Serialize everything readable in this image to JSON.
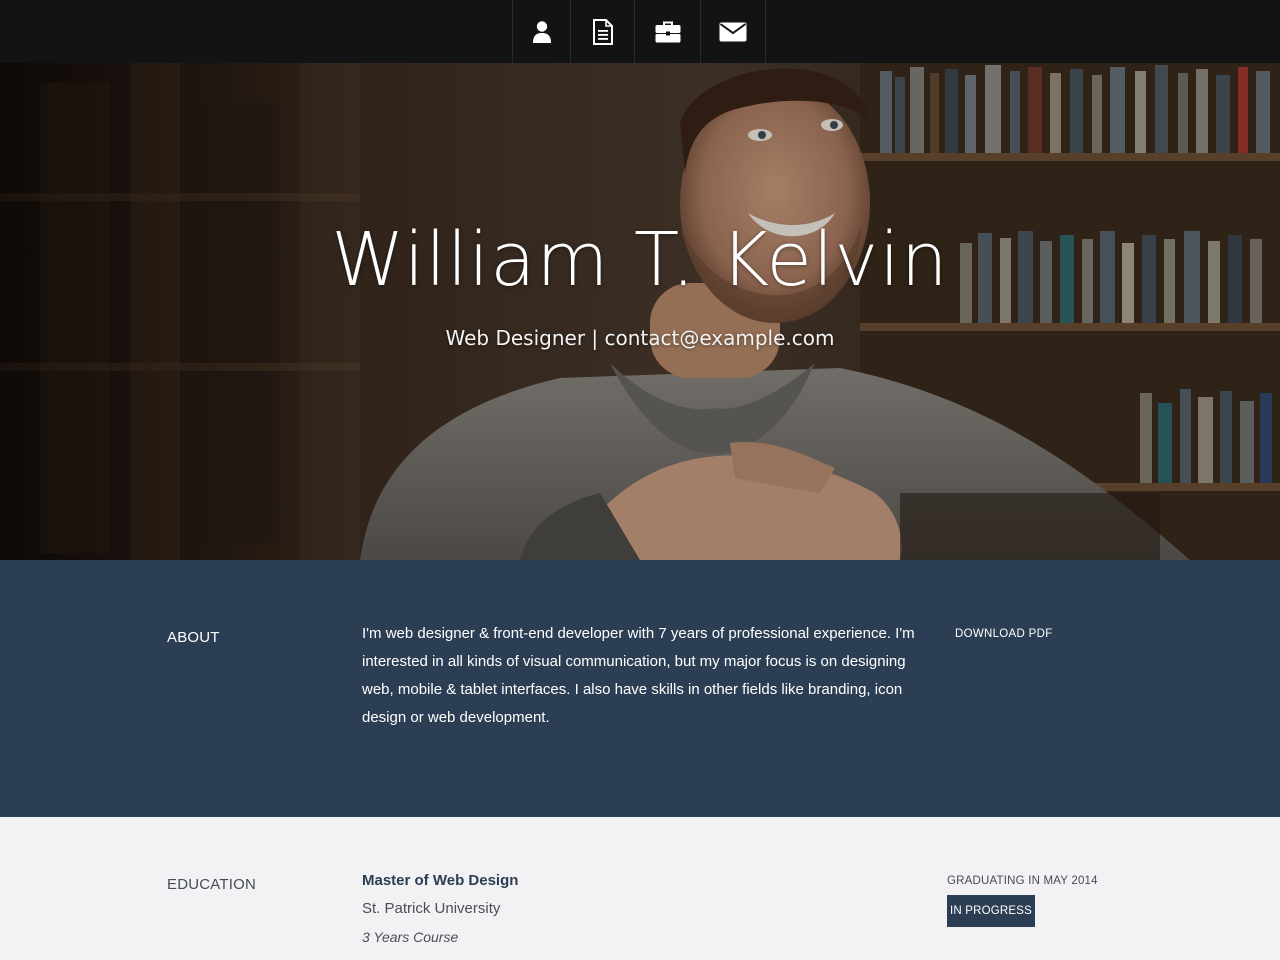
{
  "nav": {
    "items": [
      {
        "icon": "user-icon"
      },
      {
        "icon": "document-icon"
      },
      {
        "icon": "briefcase-icon"
      },
      {
        "icon": "envelope-icon"
      }
    ]
  },
  "hero": {
    "name": "William T. Kelvin",
    "subtitle": "Web Designer | contact@example.com"
  },
  "about": {
    "label": "ABOUT",
    "text": "I'm web designer & front-end developer with 7 years of professional experience. I'm interested in all kinds of visual communication, but my major focus is on designing web, mobile & tablet interfaces. I also have skills in other fields like branding, icon design or web development.",
    "download_label": "DOWNLOAD PDF"
  },
  "education": {
    "label": "EDUCATION",
    "degree": "Master of Web Design",
    "school": "St. Patrick University",
    "course": "3 Years Course",
    "graduating": "GRADUATING IN MAY 2014",
    "status": "IN PROGRESS"
  },
  "colors": {
    "nav_bg": "#131313",
    "about_bg": "#2c3e53",
    "education_bg": "#f2f2f4",
    "badge_bg": "#2c3e53"
  }
}
